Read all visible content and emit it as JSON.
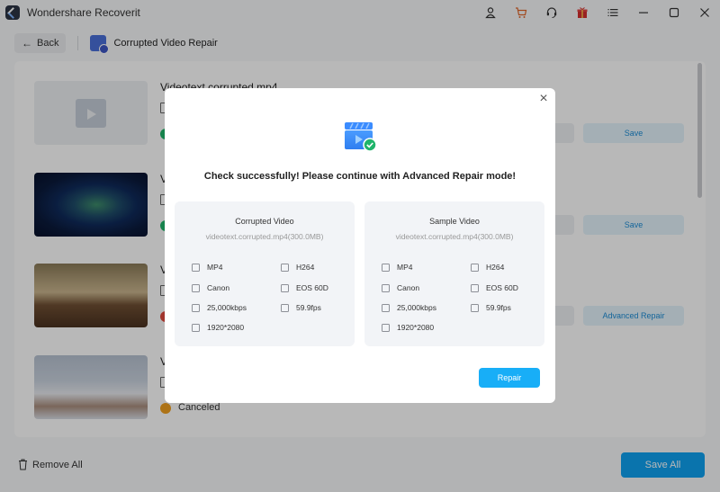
{
  "app": {
    "title": "Wondershare Recoverit",
    "title_icons": [
      "user-icon",
      "cart-icon",
      "headset-icon",
      "gift-icon",
      "menu-icon",
      "minimize-icon",
      "maximize-icon",
      "close-icon"
    ],
    "accent_color": "#0ea1f0"
  },
  "header": {
    "back_label": "Back",
    "page_title": "Corrupted Video Repair"
  },
  "list": {
    "items": [
      {
        "title": "Videotext corrupted.mp4",
        "status": "success",
        "status_text": "",
        "action_label": "Save",
        "thumb": "placeholder"
      },
      {
        "title": "V",
        "status": "success",
        "status_text": "",
        "action_label": "Save",
        "thumb": "tunnel"
      },
      {
        "title": "V",
        "status": "error",
        "status_text": "",
        "action_label": "Advanced Repair",
        "thumb": "library"
      },
      {
        "title": "V",
        "status": "warning",
        "status_text": "Canceled",
        "action_label": "",
        "thumb": "city"
      }
    ]
  },
  "footer": {
    "remove_all_label": "Remove All",
    "save_all_label": "Save All"
  },
  "modal": {
    "message": "Check successfully! Please continue with Advanced Repair mode!",
    "repair_label": "Repair",
    "cards": [
      {
        "title": "Corrupted Video",
        "file": "videotext.corrupted.mp4(300.0MB)",
        "props": {
          "format": "MP4",
          "codec": "H264",
          "brand": "Canon",
          "model": "EOS 60D",
          "bitrate": "25,000kbps",
          "fps": "59.9fps",
          "resolution": "1920*2080"
        }
      },
      {
        "title": "Sample Video",
        "file": "videotext.corrupted.mp4(300.0MB)",
        "props": {
          "format": "MP4",
          "codec": "H264",
          "brand": "Canon",
          "model": "EOS 60D",
          "bitrate": "25,000kbps",
          "fps": "59.9fps",
          "resolution": "1920*2080"
        }
      }
    ]
  }
}
